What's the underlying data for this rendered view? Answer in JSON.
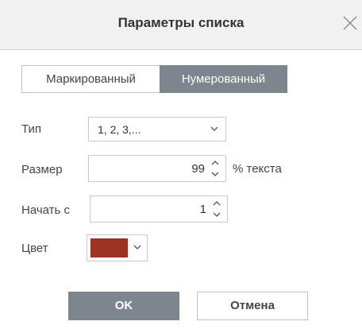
{
  "dialog": {
    "title": "Параметры списка",
    "close_icon": "close-icon"
  },
  "tabs": [
    {
      "label": "Маркированный",
      "active": false
    },
    {
      "label": "Нумерованный",
      "active": true
    }
  ],
  "fields": {
    "type": {
      "label": "Тип",
      "value": "1, 2, 3,..."
    },
    "size": {
      "label": "Размер",
      "value": "99",
      "suffix": "% текста"
    },
    "start": {
      "label": "Начать с",
      "value": "1"
    },
    "color": {
      "label": "Цвет",
      "value": "#9e3222"
    }
  },
  "buttons": {
    "ok": "OK",
    "cancel": "Отмена"
  },
  "colors": {
    "accent": "#7d858e",
    "titlebar_bg": "#f1f1f1",
    "border": "#c8c8c8"
  }
}
